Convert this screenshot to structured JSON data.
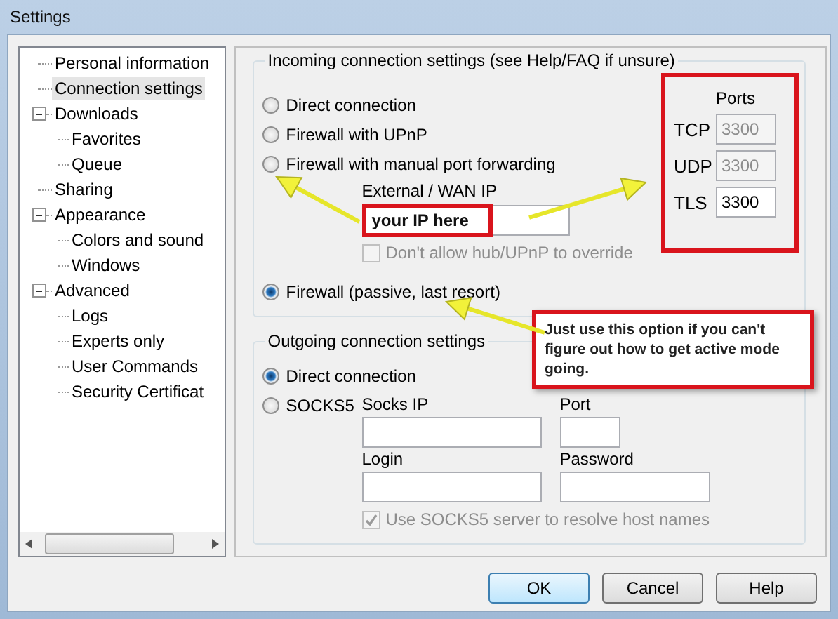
{
  "window": {
    "title": "Settings"
  },
  "tree": [
    {
      "label": "Personal information",
      "selected": false
    },
    {
      "label": "Connection settings",
      "selected": true
    },
    {
      "label": "Downloads",
      "selected": false,
      "expanded": true,
      "children": [
        {
          "label": "Favorites",
          "selected": false
        },
        {
          "label": "Queue",
          "selected": false
        }
      ]
    },
    {
      "label": "Sharing",
      "selected": false
    },
    {
      "label": "Appearance",
      "selected": false,
      "expanded": true,
      "children": [
        {
          "label": "Colors and sound",
          "selected": false
        },
        {
          "label": "Windows",
          "selected": false
        }
      ]
    },
    {
      "label": "Advanced",
      "selected": false,
      "expanded": true,
      "children": [
        {
          "label": "Logs",
          "selected": false
        },
        {
          "label": "Experts only",
          "selected": false
        },
        {
          "label": "User Commands",
          "selected": false
        },
        {
          "label": "Security Certificat",
          "selected": false
        }
      ]
    }
  ],
  "incoming": {
    "legend": "Incoming connection settings (see Help/FAQ if unsure)",
    "options": [
      {
        "label": "Direct connection",
        "selected": false
      },
      {
        "label": "Firewall with UPnP",
        "selected": false
      },
      {
        "label": "Firewall with manual port forwarding",
        "selected": false
      },
      {
        "label": "Firewall (passive, last resort)",
        "selected": true
      }
    ],
    "wan_ip": {
      "label": "External / WAN IP",
      "value": "your IP here"
    },
    "override": {
      "label": "Don't allow hub/UPnP to override",
      "checked": false,
      "disabled": true
    }
  },
  "ports": {
    "title": "Ports",
    "rows": [
      {
        "label": "TCP",
        "value": "3300",
        "disabled": true
      },
      {
        "label": "UDP",
        "value": "3300",
        "disabled": true
      },
      {
        "label": "TLS",
        "value": "3300",
        "disabled": false
      }
    ]
  },
  "outgoing": {
    "legend": "Outgoing connection settings",
    "options": [
      {
        "label": "Direct connection",
        "selected": true
      },
      {
        "label": "SOCKS5",
        "selected": false
      }
    ],
    "fields": [
      {
        "label": "Socks IP"
      },
      {
        "label": "Port"
      },
      {
        "label": "Login"
      },
      {
        "label": "Password"
      }
    ],
    "resolve": {
      "label": "Use SOCKS5 server to resolve host names",
      "checked": true,
      "disabled": true
    }
  },
  "buttons": [
    {
      "label": "OK",
      "default": true
    },
    {
      "label": "Cancel",
      "default": false
    },
    {
      "label": "Help",
      "default": false
    }
  ],
  "callout": {
    "text": "Just use this option if you can't figure out how to get active mode going."
  }
}
